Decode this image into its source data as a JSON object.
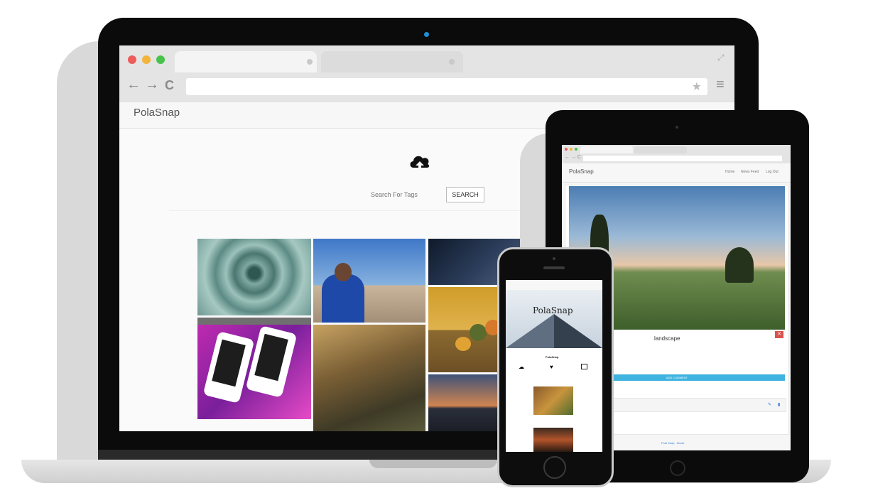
{
  "laptop": {
    "brand": "PolaSnap",
    "search": {
      "placeholder": "Search For Tags",
      "button": "SEARCH"
    },
    "icons": {
      "cloud": "cloud-upload-icon",
      "back": "←",
      "forward": "→",
      "reload": "C",
      "star": "★",
      "menu": "≡"
    }
  },
  "tablet": {
    "brand": "PolaSnap",
    "nav": [
      "Home",
      "News Feed",
      "Log Out"
    ],
    "post_title": "landscape",
    "add_comment": "ADD COMMENT",
    "footer": "Pola Snap · About"
  },
  "phone": {
    "hero_title": "PolaSnap",
    "section_title": "PolaSnap"
  },
  "colors": {
    "accent": "#40b4e0",
    "danger": "#d9534f"
  }
}
